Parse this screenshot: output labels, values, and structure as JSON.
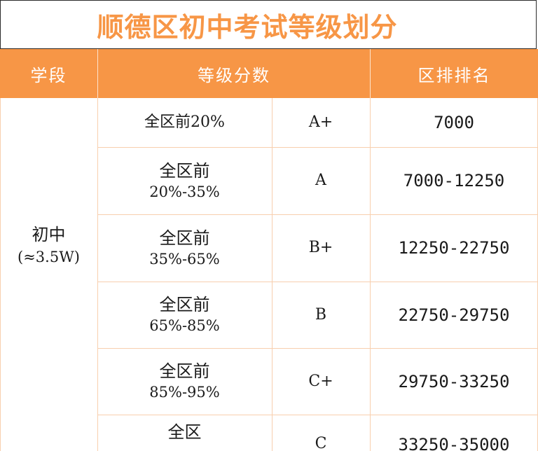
{
  "title": "顺德区初中考试等级划分",
  "headers": {
    "stage": "学段",
    "grade_score": "等级分数",
    "rank": "区排排名"
  },
  "stage": {
    "name": "初中",
    "note": "(≈3.5W)"
  },
  "rows": [
    {
      "range_top": "全区前20%",
      "range_bottom": "",
      "grade": "A+",
      "rank": "7000"
    },
    {
      "range_top": "全区前",
      "range_bottom": "20%-35%",
      "grade": "A",
      "rank": "7000-12250"
    },
    {
      "range_top": "全区前",
      "range_bottom": "35%-65%",
      "grade": "B+",
      "rank": "12250-22750"
    },
    {
      "range_top": "全区前",
      "range_bottom": "65%-85%",
      "grade": "B",
      "rank": "22750-29750"
    },
    {
      "range_top": "全区前",
      "range_bottom": "85%-95%",
      "grade": "C+",
      "rank": "29750-33250"
    },
    {
      "range_top": "全区",
      "range_bottom": "",
      "grade": "C",
      "rank": "33250-35000"
    }
  ]
}
